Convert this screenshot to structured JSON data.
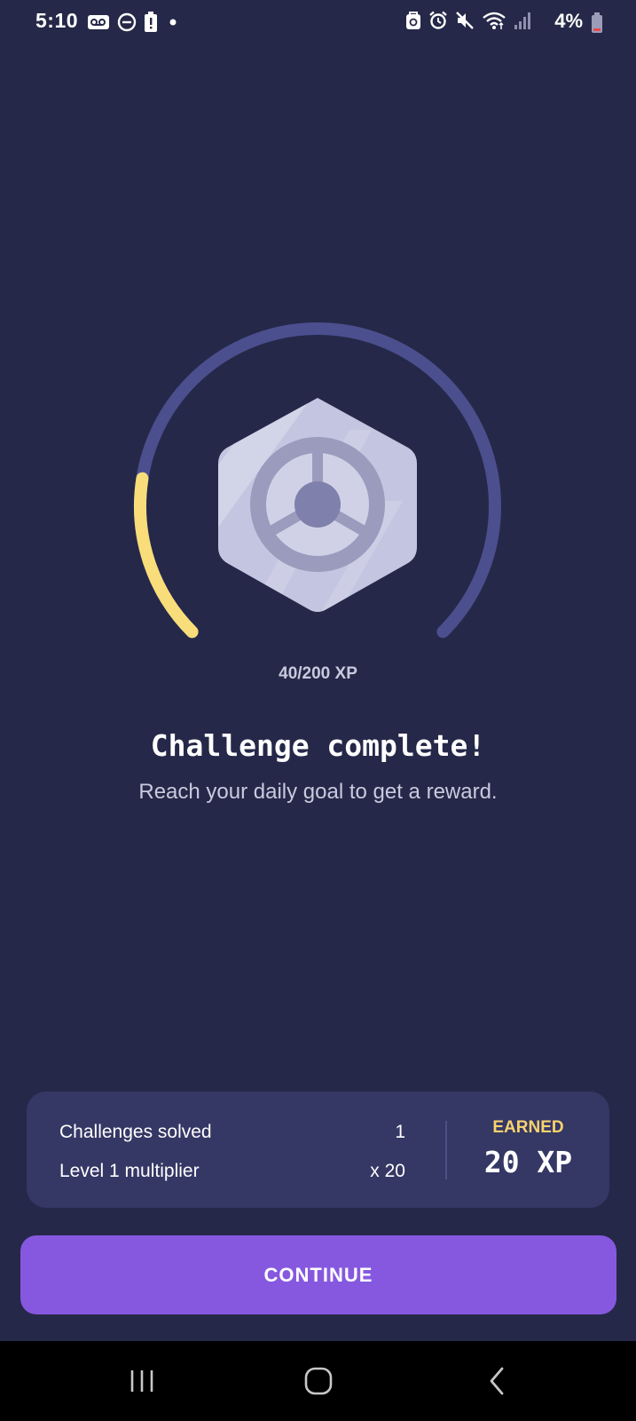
{
  "status_bar": {
    "time": "5:10",
    "battery": "4%",
    "left_icons": [
      "voicemail-icon",
      "do-not-disturb-icon",
      "battery-alert-icon",
      "dot-icon"
    ],
    "right_icons": [
      "package-icon",
      "alarm-icon",
      "mute-icon",
      "wifi-icon",
      "signal-icon",
      "battery-icon"
    ]
  },
  "progress": {
    "text": "40/200 XP",
    "current": 40,
    "goal": 200
  },
  "badge": {
    "icon": "steering-wheel-icon"
  },
  "heading": {
    "title": "Challenge complete!",
    "subtitle": "Reach your daily goal to get a reward."
  },
  "summary": {
    "rows": [
      {
        "label": "Challenges solved",
        "value": "1"
      },
      {
        "label": "Level 1 multiplier",
        "value": "x 20"
      }
    ],
    "earned_label": "EARNED",
    "earned_value": "20 XP"
  },
  "continue_label": "CONTINUE",
  "nav": {
    "items": [
      "recent-apps-icon",
      "home-icon",
      "back-icon"
    ]
  },
  "colors": {
    "background": "#252848",
    "ring_track": "#4b4f8e",
    "ring_progress": "#f8dd7a",
    "card": "#353765",
    "earned": "#f8d36e",
    "button": "#8658df"
  }
}
